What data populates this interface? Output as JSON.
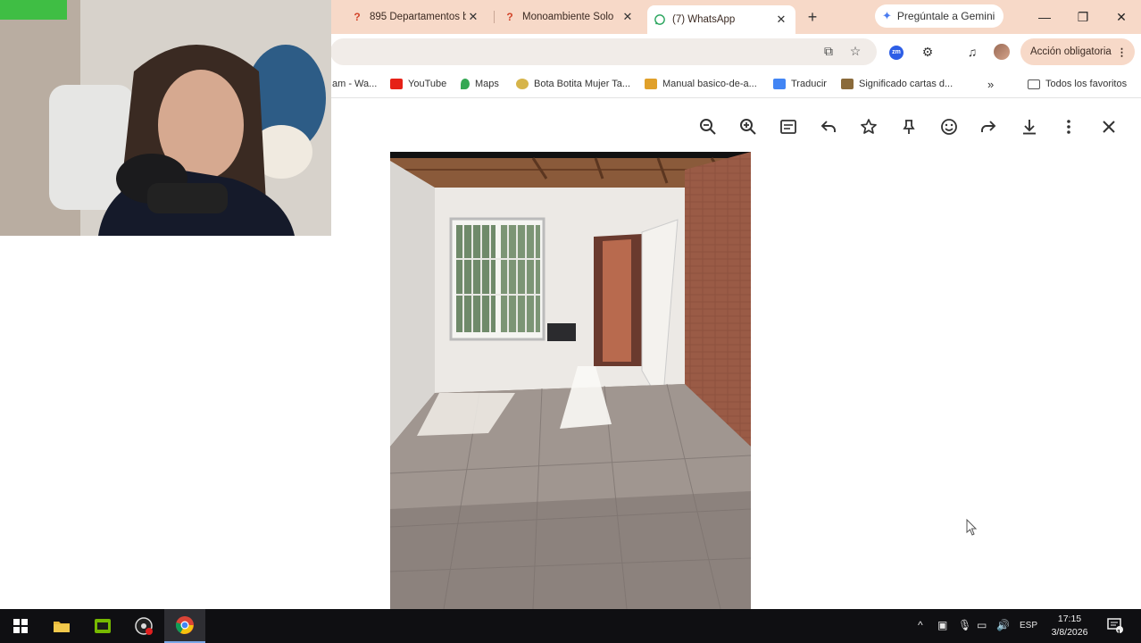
{
  "tabs": [
    {
      "label": "895 Departamentos b",
      "favicon": "?",
      "active": false
    },
    {
      "label": "Monoambiente Solo",
      "favicon": "?",
      "active": false
    },
    {
      "label": "(7) WhatsApp",
      "favicon": "whatsapp-icon",
      "active": true
    }
  ],
  "gemini_label": "Pregúntale a Gemini",
  "accion_label": "Acción obligatoria",
  "bookmarks": [
    {
      "label": "am - Wa...",
      "color": "#ffffff"
    },
    {
      "label": "YouTube",
      "color": "#e62117"
    },
    {
      "label": "Maps",
      "color": "#34a853"
    },
    {
      "label": "Bota Botita Mujer Ta...",
      "color": "#b8962e"
    },
    {
      "label": "Manual basico-de-a...",
      "color": "#e0a02a"
    },
    {
      "label": "Traducir",
      "color": "#4285f4"
    },
    {
      "label": "Significado cartas d...",
      "color": "#8a6a3a"
    }
  ],
  "all_bookmarks_label": "Todos los favoritos",
  "viewer_icons": [
    "zoom-out-icon",
    "zoom-in-icon",
    "caption-icon",
    "reply-icon",
    "star-icon",
    "pin-icon",
    "emoji-icon",
    "forward-icon",
    "download-icon",
    "more-icon",
    "close-icon"
  ],
  "taskbar": {
    "lang": "ESP",
    "time": "17:15",
    "date": "3/8/2026",
    "notification_count": "1"
  }
}
